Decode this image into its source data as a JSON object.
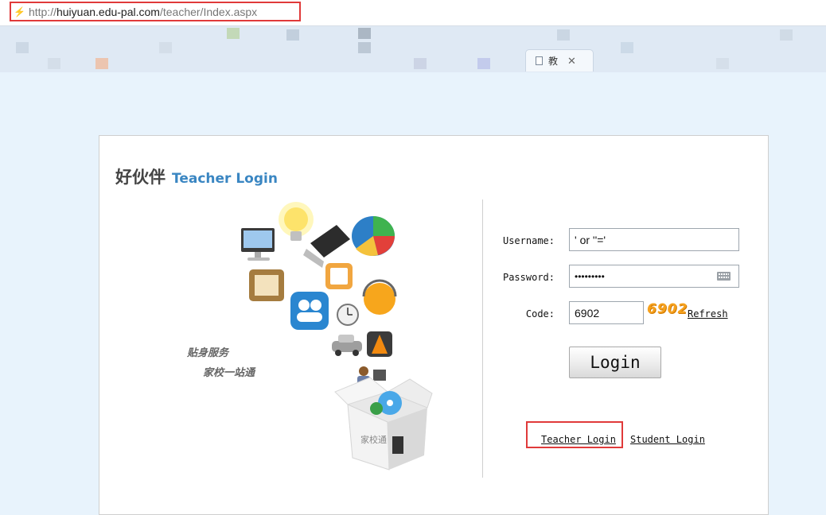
{
  "browser": {
    "url_prefix": "http://",
    "url_host": "huiyuan.edu-pal.com",
    "url_path": "/teacher/Index.aspx",
    "tab_label": "教"
  },
  "header": {
    "brand_cn": "好伙伴",
    "brand_en": "Teacher Login"
  },
  "illustration": {
    "slogan_line1": "贴身服务",
    "slogan_line2": "家校一站通",
    "box_label": "家校通"
  },
  "form": {
    "username_label": "Username:",
    "username_value": "' or ''='",
    "password_label": "Password:",
    "password_value": "•••••••••",
    "code_label": "Code:",
    "code_value": "6902",
    "captcha_text": "6902",
    "refresh_label": "Refresh",
    "login_label": "Login"
  },
  "links": {
    "teacher_login": "Teacher Login",
    "student_login": "Student Login"
  },
  "colors": {
    "page_bg": "#e8f3fc",
    "brand_accent": "#3a86c2",
    "highlight_red": "#e03a3a",
    "captcha_orange": "#f6a11d"
  }
}
